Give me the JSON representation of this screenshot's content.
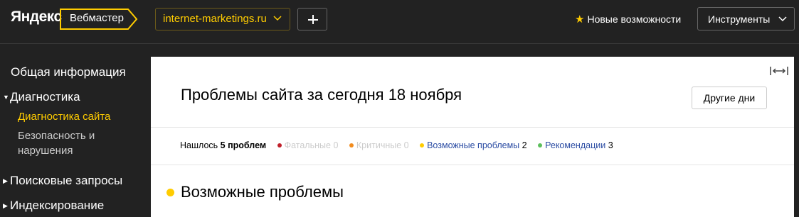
{
  "header": {
    "logo": "Яндекс",
    "service": "Вебмастер",
    "site": "internet-marketings.ru",
    "new_features": "Новые возможности",
    "tools": "Инструменты"
  },
  "sidebar": {
    "items": [
      {
        "label": "Общая информация"
      },
      {
        "label": "Диагностика",
        "expanded": true
      },
      {
        "label": "Диагностика сайта",
        "active": true
      },
      {
        "label_line1": "Безопасность и",
        "label_line2": "нарушения"
      },
      {
        "label": "Поисковые запросы"
      },
      {
        "label": "Индексирование"
      }
    ]
  },
  "main": {
    "title": "Проблемы сайта за сегодня 18 ноября",
    "other_days": "Другие дни",
    "summary": {
      "found_label": "Нашлось",
      "found_value": "5 проблем",
      "fatal_label": "Фатальные",
      "fatal_count": "0",
      "critical_label": "Критичные",
      "critical_count": "0",
      "possible_label": "Возможные проблемы",
      "possible_count": "2",
      "recommend_label": "Рекомендации",
      "recommend_count": "3"
    },
    "section_title": "Возможные проблемы"
  },
  "colors": {
    "accent": "#ffcc00",
    "fatal": "#c0202a",
    "critical": "#f28c1e",
    "possible": "#ffcc00",
    "recommend": "#5cbf5c",
    "link": "#2b4ca3"
  }
}
